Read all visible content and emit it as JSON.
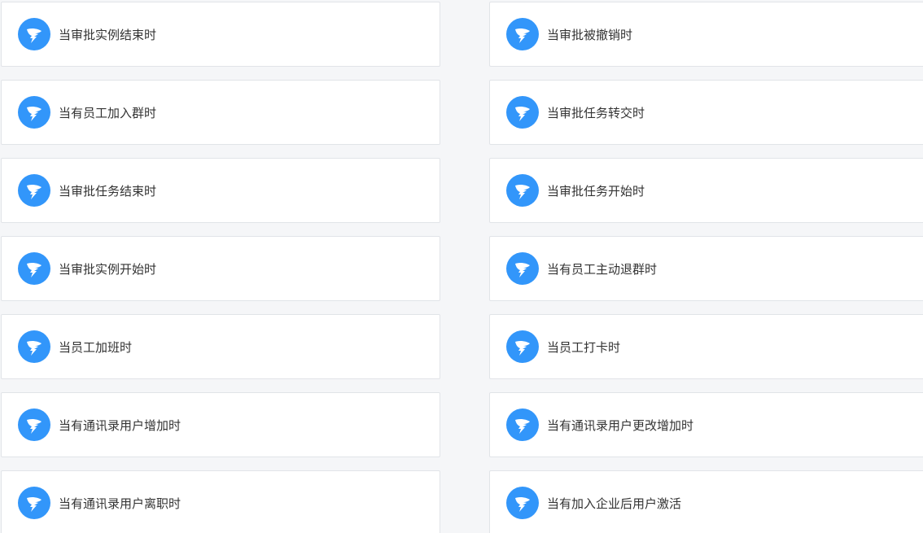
{
  "colors": {
    "page_bg": "#f5f6f8",
    "card_bg": "#ffffff",
    "card_border": "#e1e4e8",
    "icon_bg": "#3296fa",
    "text": "#333333"
  },
  "icon": "dingtalk-logo-icon",
  "triggers": [
    {
      "label": "当审批实例结束时"
    },
    {
      "label": "当审批被撤销时"
    },
    {
      "label": "当有员工加入群时"
    },
    {
      "label": "当审批任务转交时"
    },
    {
      "label": "当审批任务结束时"
    },
    {
      "label": "当审批任务开始时"
    },
    {
      "label": "当审批实例开始时"
    },
    {
      "label": "当有员工主动退群时"
    },
    {
      "label": "当员工加班时"
    },
    {
      "label": "当员工打卡时"
    },
    {
      "label": "当有通讯录用户增加时"
    },
    {
      "label": "当有通讯录用户更改增加时"
    },
    {
      "label": "当有通讯录用户离职时"
    },
    {
      "label": "当有加入企业后用户激活"
    }
  ]
}
